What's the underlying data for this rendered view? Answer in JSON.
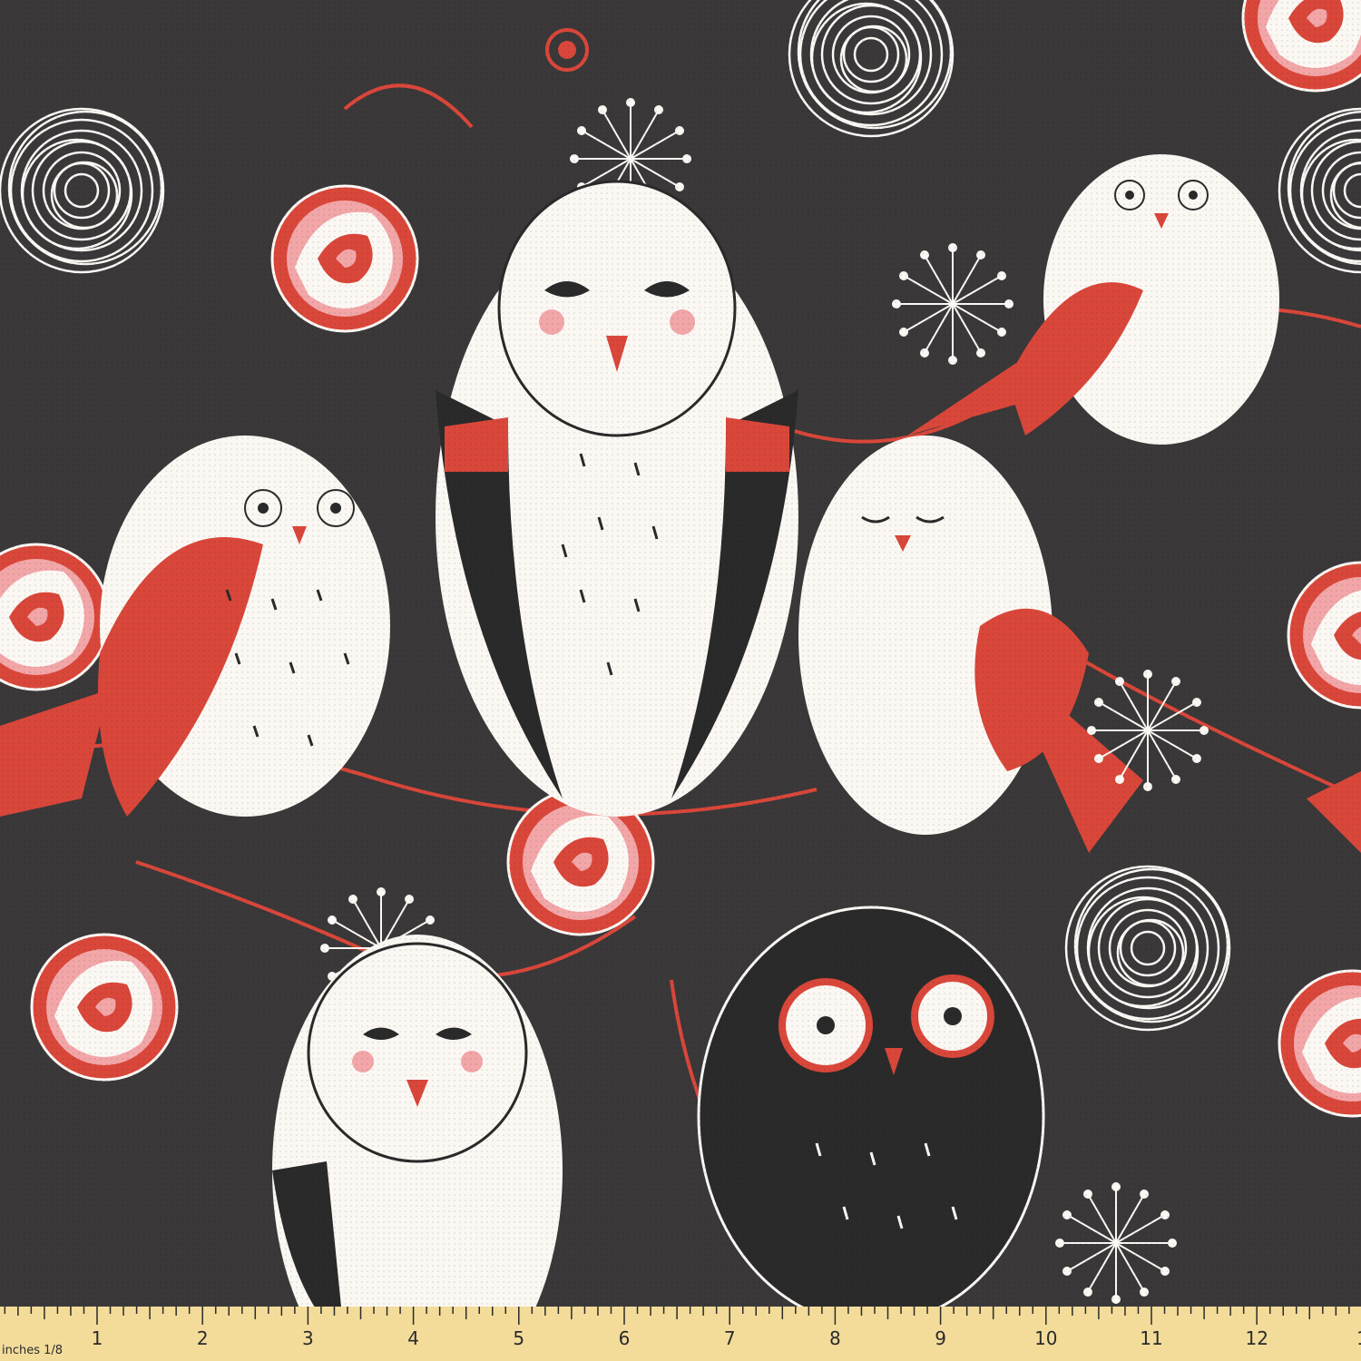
{
  "colors": {
    "background": "#3a3839",
    "white": "#fbf8f4",
    "coral": "#d9473a",
    "pink": "#f2a6a8",
    "ink": "#2b2a2a",
    "ruler": "#f3dc9a"
  },
  "ruler": {
    "label": "inches 1/8",
    "numbers": [
      "1",
      "2",
      "3",
      "4",
      "5",
      "6",
      "7",
      "8",
      "9",
      "10",
      "11",
      "12",
      "1"
    ]
  }
}
